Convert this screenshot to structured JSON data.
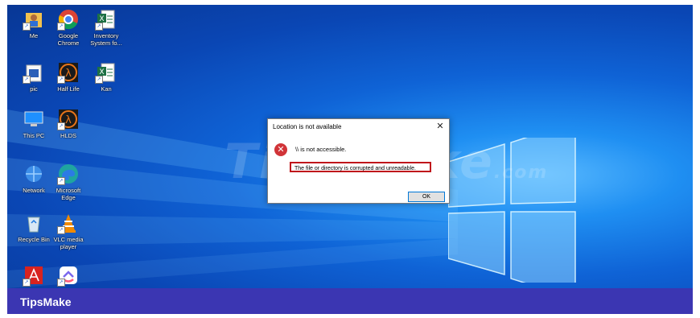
{
  "desktop": {
    "icons": [
      {
        "label": "Me",
        "icon": "user-folder-icon"
      },
      {
        "label": "Google Chrome",
        "icon": "chrome-icon"
      },
      {
        "label": "Inventory System fo...",
        "icon": "excel-file-icon"
      },
      {
        "label": "pic",
        "icon": "folder-icon"
      },
      {
        "label": "Half Life",
        "icon": "half-life-icon"
      },
      {
        "label": "Kan",
        "icon": "excel-file-icon"
      },
      {
        "label": "This PC",
        "icon": "computer-icon"
      },
      {
        "label": "HLDS",
        "icon": "half-life-icon"
      },
      {
        "label": "Network",
        "icon": "network-icon"
      },
      {
        "label": "Microsoft Edge",
        "icon": "edge-icon"
      },
      {
        "label": "Recycle Bin",
        "icon": "recycle-bin-icon"
      },
      {
        "label": "VLC media player",
        "icon": "vlc-icon"
      },
      {
        "label": "",
        "icon": "acrobat-icon"
      },
      {
        "label": "",
        "icon": "clickup-icon"
      }
    ]
  },
  "watermark": {
    "main": "TipsMake",
    "domain": ".com"
  },
  "dialog": {
    "title": "Location is not available",
    "close_glyph": "✕",
    "message": "\\\\ is not accessible.",
    "detail": "The file or directory is corrupted and unreadable.",
    "ok_label": "OK",
    "icon": "error-icon"
  },
  "footer": {
    "brand": "TipsMake"
  }
}
